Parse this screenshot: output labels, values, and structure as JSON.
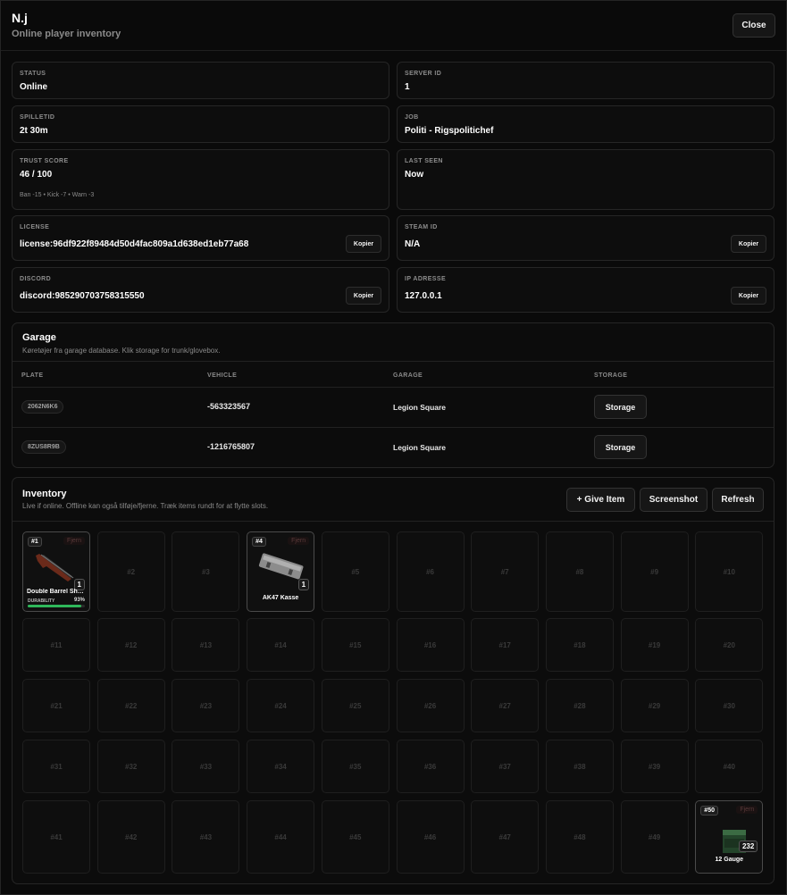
{
  "header": {
    "title": "N.j",
    "subtitle": "Online player inventory",
    "close_label": "Close"
  },
  "info": {
    "status": {
      "label": "STATUS",
      "value": "Online"
    },
    "server_id": {
      "label": "SERVER ID",
      "value": "1"
    },
    "playtime": {
      "label": "SPILLETID",
      "value": "2t 30m"
    },
    "job": {
      "label": "JOB",
      "value": "Politi - Rigspolitichef"
    },
    "trust": {
      "label": "TRUST SCORE",
      "value": "46 / 100",
      "detail": "Ban -15 • Kick -7 • Warn -3"
    },
    "last_seen": {
      "label": "LAST SEEN",
      "value": "Now"
    },
    "license": {
      "label": "LICENSE",
      "value": "license:96df922f89484d50d4fac809a1d638ed1eb77a68"
    },
    "steam": {
      "label": "STEAM ID",
      "value": "N/A"
    },
    "discord": {
      "label": "DISCORD",
      "value": "discord:985290703758315550"
    },
    "ip": {
      "label": "IP ADRESSE",
      "value": "127.0.0.1"
    },
    "copy_label": "Kopier"
  },
  "garage": {
    "title": "Garage",
    "description": "Køretøjer fra garage database. Klik storage for trunk/glovebox.",
    "columns": [
      "PLATE",
      "VEHICLE",
      "GARAGE",
      "STORAGE"
    ],
    "storage_label": "Storage",
    "rows": [
      {
        "plate": "2062N6K6",
        "vehicle": "-563323567",
        "garage": "Legion Square"
      },
      {
        "plate": "8ZUS8R9B",
        "vehicle": "-1216765807",
        "garage": "Legion Square"
      }
    ]
  },
  "inventory": {
    "title": "Inventory",
    "description": "Live if online. Offline kan også tilføje/fjerne. Træk items rundt for at flytte slots.",
    "give_label": "+ Give Item",
    "screenshot_label": "Screenshot",
    "refresh_label": "Refresh",
    "remove_label": "Fjern",
    "durability_label": "DURABILITY",
    "slot_count": 50,
    "items": [
      {
        "slot": 1,
        "tag": "#1",
        "name": "Double Barrel Sho...",
        "qty": "1",
        "durability": 93,
        "durability_text": "93%",
        "icon": "shotgun-icon"
      },
      {
        "slot": 4,
        "tag": "#4",
        "name": "AK47 Kasse",
        "qty": "1",
        "icon": "weapon-case-icon"
      },
      {
        "slot": 50,
        "tag": "#50",
        "name": "12 Gauge",
        "qty": "232",
        "icon": "ammo-box-icon"
      }
    ]
  }
}
